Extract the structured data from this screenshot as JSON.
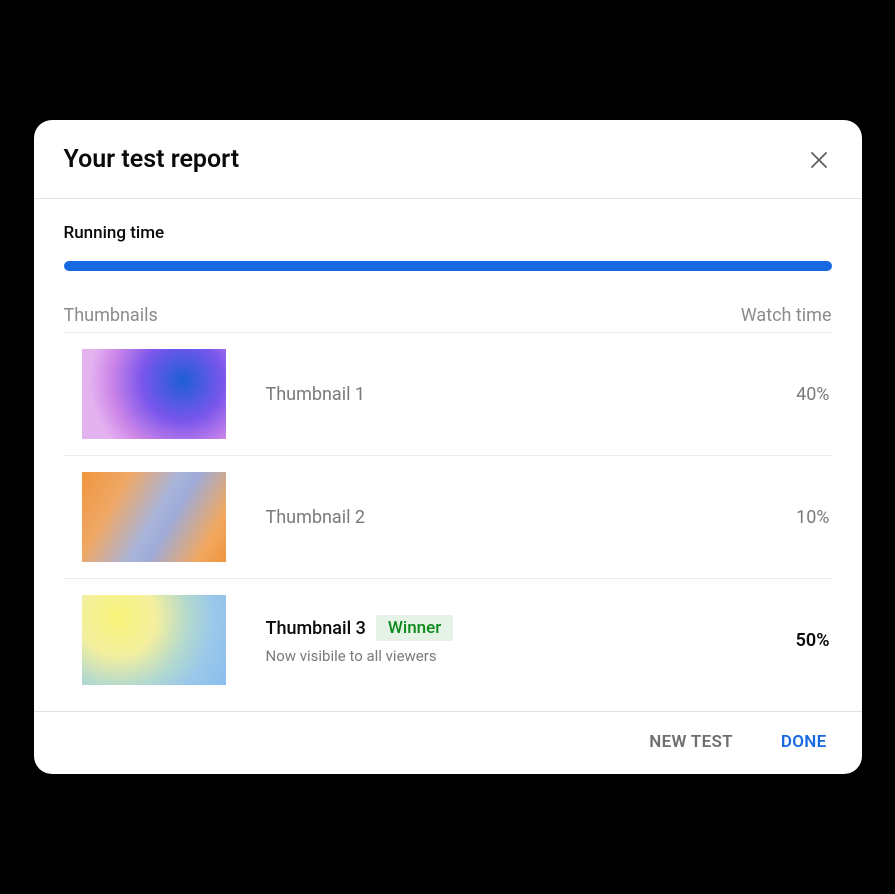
{
  "dialog": {
    "title": "Your test report",
    "running_time_label": "Running time",
    "progress_percent": 100,
    "columns": {
      "thumbnails": "Thumbnails",
      "watch_time": "Watch time"
    },
    "rows": [
      {
        "title": "Thumbnail 1",
        "watch_time": "40%",
        "is_winner": false,
        "subtitle": ""
      },
      {
        "title": "Thumbnail 2",
        "watch_time": "10%",
        "is_winner": false,
        "subtitle": ""
      },
      {
        "title": "Thumbnail 3",
        "watch_time": "50%",
        "is_winner": true,
        "winner_label": "Winner",
        "subtitle": "Now visibile to all viewers"
      }
    ],
    "footer": {
      "new_test": "NEW TEST",
      "done": "DONE"
    }
  },
  "colors": {
    "accent": "#1669e0",
    "winner_green": "#0f8a1c",
    "winner_bg": "#e4f3e5"
  }
}
